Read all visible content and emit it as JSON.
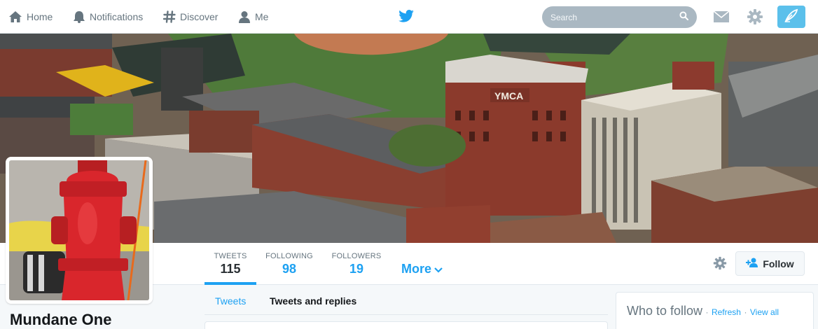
{
  "nav": {
    "home": "Home",
    "notifications": "Notifications",
    "discover": "Discover",
    "me": "Me",
    "search_placeholder": "Search"
  },
  "profile": {
    "name": "Mundane One",
    "stats": {
      "tweets_label": "TWEETS",
      "tweets_value": "115",
      "following_label": "FOLLOWING",
      "following_value": "98",
      "followers_label": "FOLLOWERS",
      "followers_value": "19"
    },
    "more_label": "More",
    "follow_label": "Follow"
  },
  "banner": {
    "sign_text": "YMCA"
  },
  "timeline": {
    "tabs": [
      "Tweets",
      "Tweets and replies"
    ]
  },
  "who_to_follow": {
    "title": "Who to follow",
    "separator": "·",
    "refresh": "Refresh",
    "view_all": "View all"
  },
  "colors": {
    "accent": "#1da1f2",
    "compose": "#5bc0eb",
    "hydrant_red": "#d9262c"
  }
}
